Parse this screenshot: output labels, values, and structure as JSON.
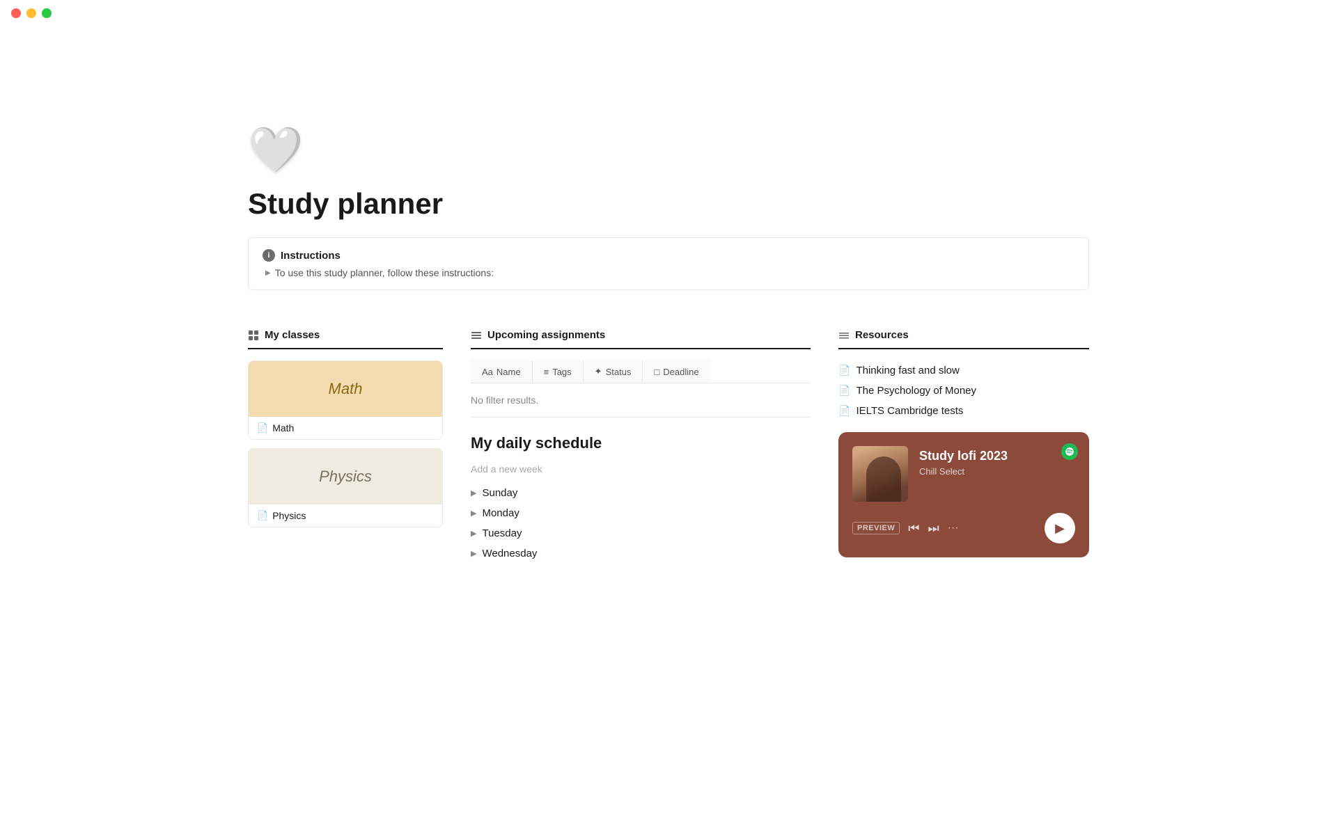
{
  "titlebar": {
    "close_label": "close",
    "minimize_label": "minimize",
    "maximize_label": "maximize"
  },
  "page": {
    "icon": "🤍",
    "title": "Study planner"
  },
  "instructions": {
    "header": "Instructions",
    "toggle_text": "To use this study planner, follow these instructions:"
  },
  "my_classes": {
    "header": "My classes",
    "items": [
      {
        "name": "Math",
        "banner_text": "Math",
        "type": "math"
      },
      {
        "name": "Physics",
        "banner_text": "Physics",
        "type": "physics"
      }
    ]
  },
  "upcoming_assignments": {
    "header": "Upcoming assignments",
    "columns": [
      {
        "label": "Name",
        "icon": "Aa"
      },
      {
        "label": "Tags",
        "icon": "≡"
      },
      {
        "label": "Status",
        "icon": "✦"
      },
      {
        "label": "Deadline",
        "icon": "□"
      }
    ],
    "empty_text": "No filter results."
  },
  "daily_schedule": {
    "title": "My daily schedule",
    "add_week_placeholder": "Add a new week",
    "days": [
      "Sunday",
      "Monday",
      "Tuesday",
      "Wednesday"
    ]
  },
  "resources": {
    "header": "Resources",
    "items": [
      {
        "title": "Thinking fast and slow"
      },
      {
        "title": "The Psychology of Money"
      },
      {
        "title": "IELTS Cambridge tests"
      }
    ]
  },
  "spotify": {
    "preview_label": "PREVIEW",
    "track_title": "Study lofi 2023",
    "artist": "Chill Select",
    "play_label": "▶",
    "prev_label": "⏮",
    "next_label": "⏭",
    "more_label": "···"
  }
}
